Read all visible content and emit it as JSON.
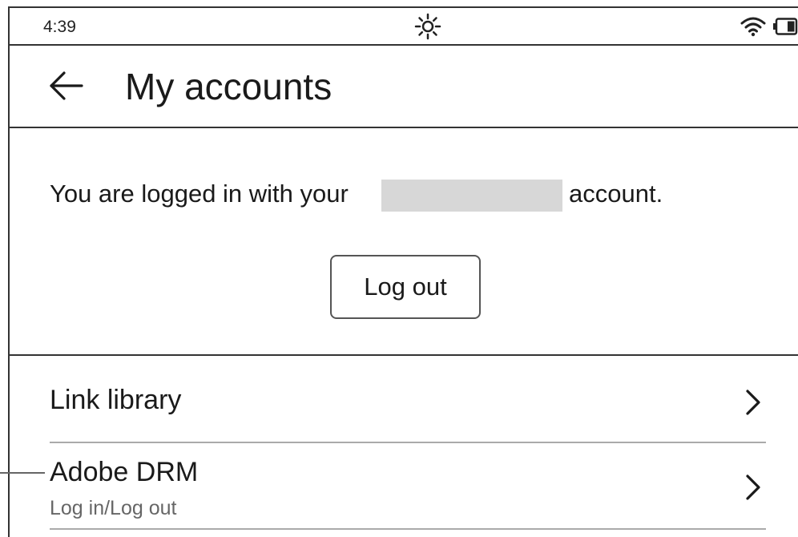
{
  "status_bar": {
    "time": "4:39",
    "icons": [
      "frontlight-sun-icon",
      "wifi-icon",
      "battery-icon"
    ]
  },
  "header": {
    "back_icon": "arrow-left-icon",
    "title": "My accounts"
  },
  "account": {
    "logged_in_prefix": "You are logged in with your",
    "logged_in_suffix": "account.",
    "logout_label": "Log out"
  },
  "list": {
    "items": [
      {
        "title": "Link library",
        "subtitle": "",
        "icon": "chevron-right-icon"
      },
      {
        "title": "Adobe DRM",
        "subtitle": "Log in/Log out",
        "icon": "chevron-right-icon"
      }
    ]
  }
}
